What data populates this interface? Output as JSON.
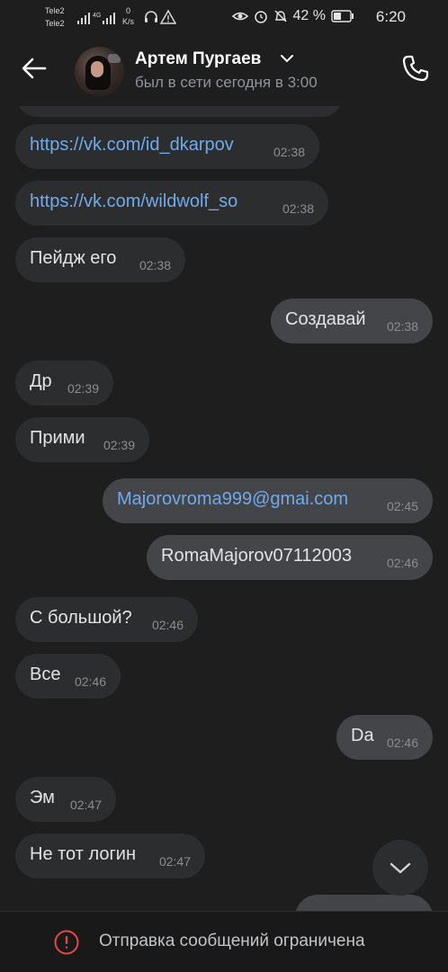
{
  "status_bar": {
    "carrier1": "Tele2",
    "carrier2": "Tele2",
    "network_type": "4G",
    "net_speed_value": "0",
    "net_speed_unit": "K/s",
    "battery": "42 %",
    "time": "6:20"
  },
  "header": {
    "name": "Артем Пургаев",
    "last_seen": "был в сети сегодня в 3:00"
  },
  "messages": [
    {
      "text": "https://vk.com/id_dkarpov",
      "time": "02:38",
      "direction": "in",
      "is_link": true
    },
    {
      "text": "https://vk.com/wildwolf_so",
      "time": "02:38",
      "direction": "in",
      "is_link": true
    },
    {
      "text": "Пейдж его",
      "time": "02:38",
      "direction": "in",
      "is_link": false
    },
    {
      "text": "Создавай",
      "time": "02:38",
      "direction": "out",
      "is_link": false
    },
    {
      "text": "Др",
      "time": "02:39",
      "direction": "in",
      "is_link": false
    },
    {
      "text": "Прими",
      "time": "02:39",
      "direction": "in",
      "is_link": false
    },
    {
      "text": "Majorovroma999@gmai.com",
      "time": "02:45",
      "direction": "out",
      "is_link": true
    },
    {
      "text": "RomaMajorov07112003",
      "time": "02:46",
      "direction": "out",
      "is_link": false
    },
    {
      "text": "С большой?",
      "time": "02:46",
      "direction": "in",
      "is_link": false
    },
    {
      "text": "Все",
      "time": "02:46",
      "direction": "in",
      "is_link": false
    },
    {
      "text": "Da",
      "time": "02:46",
      "direction": "out",
      "is_link": false
    },
    {
      "text": "Эм",
      "time": "02:47",
      "direction": "in",
      "is_link": false
    },
    {
      "text": "Не тот логин",
      "time": "02:47",
      "direction": "in",
      "is_link": false
    }
  ],
  "footer": {
    "restriction_text": "Отправка сообщений ограничена"
  },
  "colors": {
    "background": "#1e1e1f",
    "incoming_bubble": "#2c2d2e",
    "outgoing_bubble": "#444548",
    "link": "#71aaeb",
    "warning": "#e64646"
  }
}
